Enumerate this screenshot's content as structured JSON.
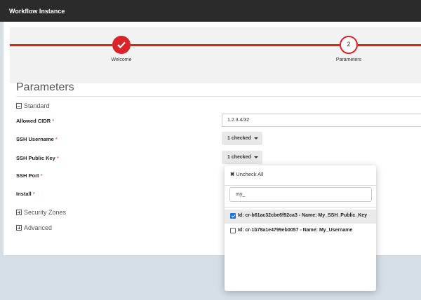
{
  "window": {
    "title": "Workflow Instance"
  },
  "wizard": {
    "steps": [
      {
        "label": "Welcome"
      },
      {
        "label": "Parameters",
        "number": "2"
      }
    ]
  },
  "section": {
    "title": "Parameters"
  },
  "groups": {
    "standard": "Standard",
    "security_zones": "Security Zones",
    "advanced": "Advanced"
  },
  "fields": {
    "allowed_cidr": {
      "label": "Allowed CIDR",
      "value": "1.2.3.4/32"
    },
    "ssh_username": {
      "label": "SSH Username",
      "value": "1 checked"
    },
    "ssh_public_key": {
      "label": "SSH Public Key",
      "value": "1 checked"
    },
    "ssh_port": {
      "label": "SSH Port"
    },
    "install": {
      "label": "Install"
    },
    "required_mark": "*"
  },
  "dropdown": {
    "uncheck_label": "Uncheck All",
    "filter_value": "my_",
    "options": [
      {
        "label": "Id: cr-b61ac32cbe6f92ca3 - Name: My_SSH_Public_Key",
        "checked": true
      },
      {
        "label": "Id: cr-1b78a1e4799eb0057 - Name: My_Username",
        "checked": false
      }
    ]
  },
  "colors": {
    "accent": "#d9252a",
    "titlebar": "#2b2b2b",
    "background": "#d5dde5"
  }
}
